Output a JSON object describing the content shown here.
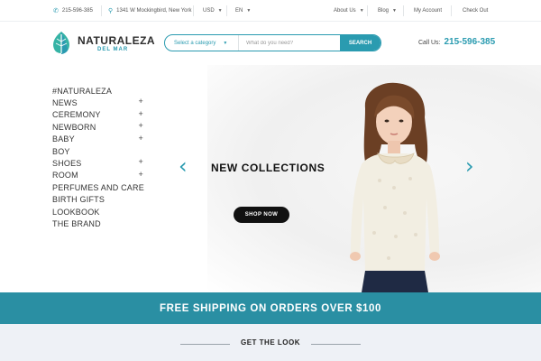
{
  "topbar": {
    "phone": "215-596-385",
    "address": "1341 W Mockingbird, New York",
    "currency": "USD",
    "language": "EN",
    "about": "About Us",
    "blog": "Blog",
    "account": "My Account",
    "checkout": "Check Out"
  },
  "header": {
    "brand": "NATURALEZA",
    "brand_sub": "DEL MAR",
    "category_select": "Select a category",
    "search_placeholder": "What do you need?",
    "search_button": "SEARCH",
    "call_label": "Call Us:",
    "call_number": "215-596-385"
  },
  "menu": [
    {
      "label": "#NATURALEZA",
      "plus": ""
    },
    {
      "label": "NEWS",
      "plus": "+"
    },
    {
      "label": "CEREMONY",
      "plus": "+"
    },
    {
      "label": "NEWBORN",
      "plus": "+"
    },
    {
      "label": "BABY",
      "plus": "+"
    },
    {
      "label": "BOY",
      "plus": ""
    },
    {
      "label": "SHOES",
      "plus": "+"
    },
    {
      "label": "ROOM",
      "plus": "+"
    },
    {
      "label": "PERFUMES AND CARE",
      "plus": ""
    },
    {
      "label": "BIRTH GIFTS",
      "plus": ""
    },
    {
      "label": "LOOKBOOK",
      "plus": ""
    },
    {
      "label": "THE BRAND",
      "plus": ""
    }
  ],
  "hero": {
    "title": "NEW COLLECTIONS",
    "button": "SHOP NOW",
    "prev_arrow": "‹",
    "next_arrow": "›"
  },
  "shipping": {
    "text": "FREE SHIPPING  ON  ORDERS OVER  $100"
  },
  "section": {
    "title": "GET THE LOOK"
  },
  "colors": {
    "accent": "#2a9bb0",
    "banner": "#2a8fa3",
    "dark": "#111111"
  }
}
